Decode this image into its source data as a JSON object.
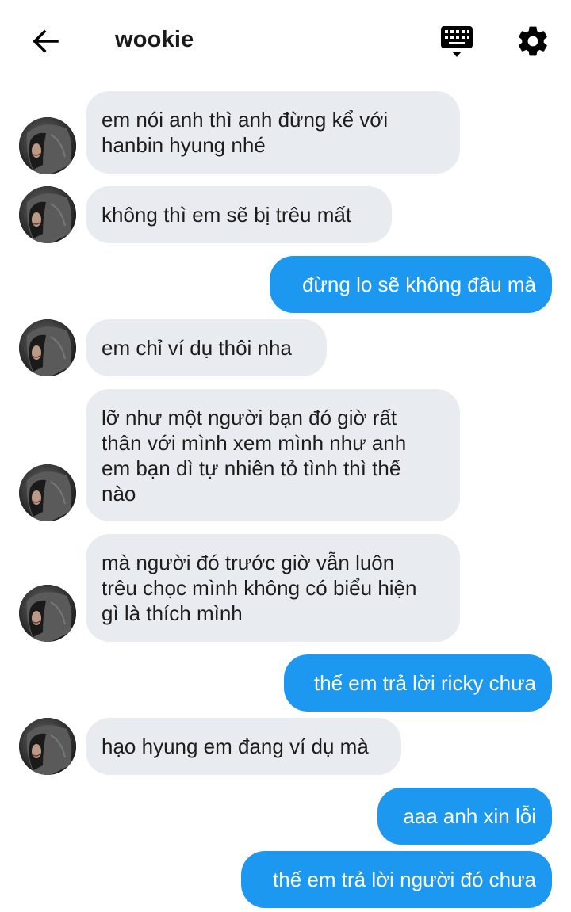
{
  "header": {
    "title": "wookie",
    "back_icon": "arrow-left-icon",
    "keyboard_icon": "keyboard-icon",
    "settings_icon": "gear-icon"
  },
  "colors": {
    "incoming_bubble": "#e8ebef",
    "outgoing_bubble": "#1c98f0",
    "incoming_text": "#1d1d1d",
    "outgoing_text": "#ffffff"
  },
  "messages": [
    {
      "from": "them",
      "text": "em nói anh thì anh đừng kể với\nhanbin hyung nhé"
    },
    {
      "from": "them",
      "text": "không thì em sẽ bị trêu mất"
    },
    {
      "from": "me",
      "text": "đừng lo sẽ không đâu mà"
    },
    {
      "from": "them",
      "text": "em chỉ ví dụ thôi nha"
    },
    {
      "from": "them",
      "text": "lỡ như một người bạn đó giờ rất\nthân với mình xem mình như anh\nem bạn dì tự nhiên tỏ tình thì thế\nnào"
    },
    {
      "from": "them",
      "text": "mà người đó trước giờ vẫn luôn\ntrêu chọc mình không có biểu hiện\ngì là thích mình"
    },
    {
      "from": "me",
      "text": "thế em trả lời ricky chưa"
    },
    {
      "from": "them",
      "text": "hạo hyung em đang ví dụ mà"
    },
    {
      "from": "me",
      "text": "aaa anh xin lỗi"
    },
    {
      "from": "me",
      "text": "thế em trả lời người đó chưa"
    }
  ]
}
